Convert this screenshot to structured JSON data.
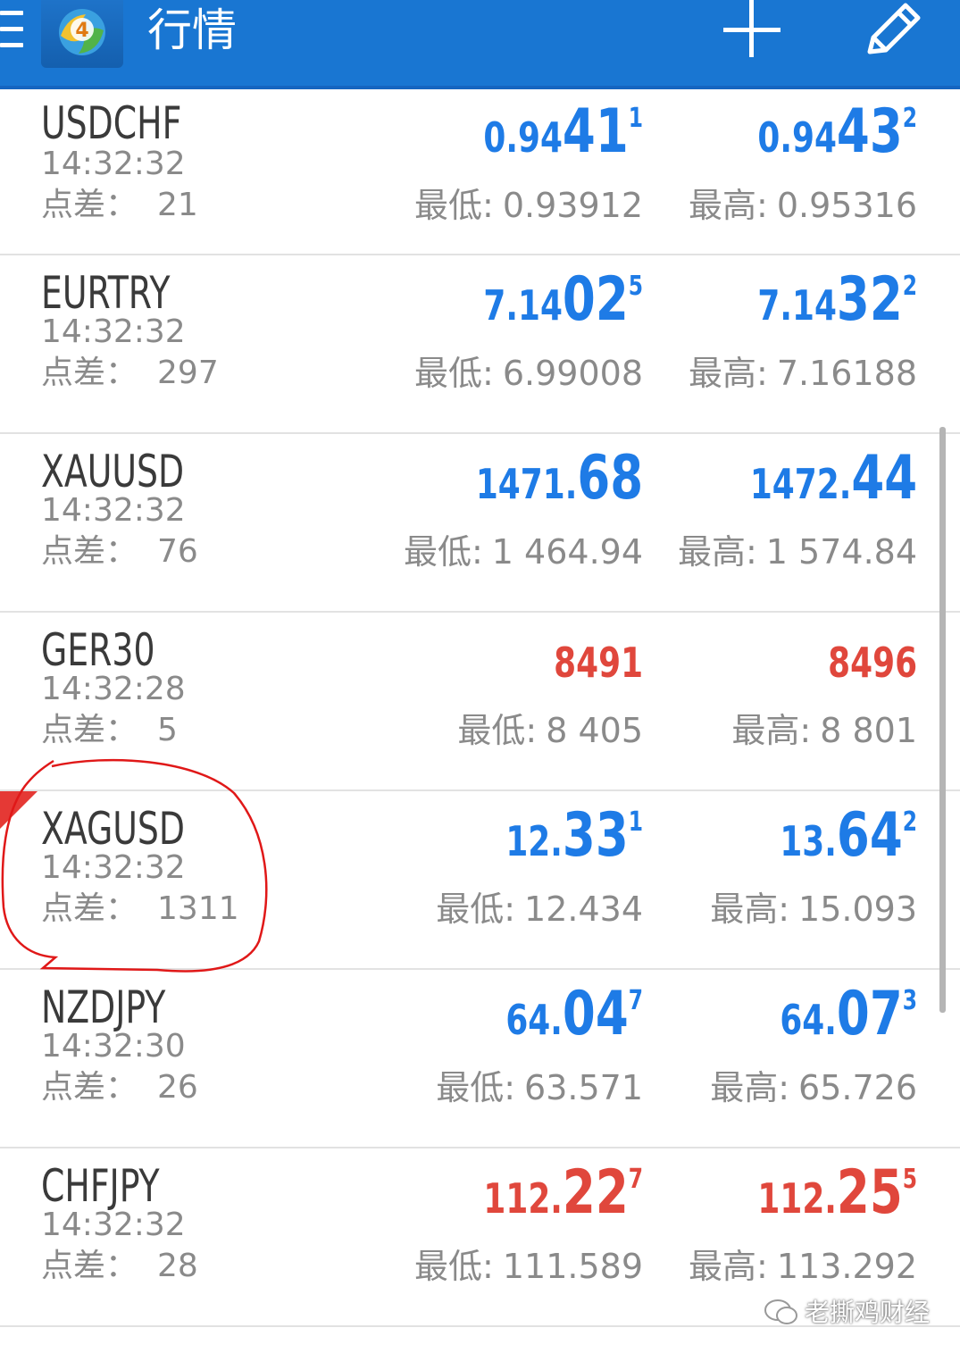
{
  "header": {
    "title": "行情",
    "logo_text": "4"
  },
  "colors": {
    "header_bg": "#1976d2",
    "price_up": "#1e7be6",
    "price_down": "#e0473c",
    "annotation": "#e01818"
  },
  "labels": {
    "spread": "点差：",
    "low": "最低:",
    "high": "最高:"
  },
  "quotes": [
    {
      "symbol": "USDCHF",
      "time": "14:32:32",
      "spread": "21",
      "bid": {
        "small": "0.94",
        "big": "41",
        "sup": "1"
      },
      "ask": {
        "small": "0.94",
        "big": "43",
        "sup": "2"
      },
      "low": "0.93912",
      "high": "0.95316",
      "direction": "up"
    },
    {
      "symbol": "EURTRY",
      "time": "14:32:32",
      "spread": "297",
      "bid": {
        "small": "7.14",
        "big": "02",
        "sup": "5"
      },
      "ask": {
        "small": "7.14",
        "big": "32",
        "sup": "2"
      },
      "low": "6.99008",
      "high": "7.16188",
      "direction": "up"
    },
    {
      "symbol": "XAUUSD",
      "time": "14:32:32",
      "spread": "76",
      "bid": {
        "small": "1471.",
        "big": "68",
        "sup": ""
      },
      "ask": {
        "small": "1472.",
        "big": "44",
        "sup": ""
      },
      "low": "1 464.94",
      "high": "1 574.84",
      "direction": "up"
    },
    {
      "symbol": "GER30",
      "time": "14:32:28",
      "spread": "5",
      "bid": {
        "small": "8491",
        "big": "",
        "sup": ""
      },
      "ask": {
        "small": "8496",
        "big": "",
        "sup": ""
      },
      "low": "8 405",
      "high": "8 801",
      "direction": "down"
    },
    {
      "symbol": "XAGUSD",
      "time": "14:32:32",
      "spread": "1311",
      "bid": {
        "small": "12.",
        "big": "33",
        "sup": "1"
      },
      "ask": {
        "small": "13.",
        "big": "64",
        "sup": "2"
      },
      "low": "12.434",
      "high": "15.093",
      "direction": "up",
      "flagged": true
    },
    {
      "symbol": "NZDJPY",
      "time": "14:32:30",
      "spread": "26",
      "bid": {
        "small": "64.",
        "big": "04",
        "sup": "7"
      },
      "ask": {
        "small": "64.",
        "big": "07",
        "sup": "3"
      },
      "low": "63.571",
      "high": "65.726",
      "direction": "up"
    },
    {
      "symbol": "CHFJPY",
      "time": "14:32:32",
      "spread": "28",
      "bid": {
        "small": "112.",
        "big": "22",
        "sup": "7"
      },
      "ask": {
        "small": "112.",
        "big": "25",
        "sup": "5"
      },
      "low": "111.589",
      "high": "113.292",
      "direction": "down"
    }
  ],
  "watermark": "老撕鸡财经"
}
